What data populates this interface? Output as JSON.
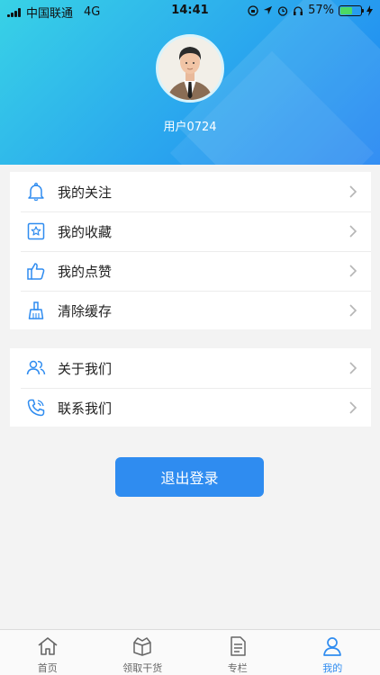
{
  "status_bar": {
    "carrier": "中国联通",
    "network": "4G",
    "time": "14:41",
    "battery": "57%",
    "battery_level": 0.57
  },
  "profile": {
    "username": "用户0724"
  },
  "menu_group_1": [
    {
      "label": "我的关注",
      "icon": "bell-icon"
    },
    {
      "label": "我的收藏",
      "icon": "star-bookmark-icon"
    },
    {
      "label": "我的点赞",
      "icon": "thumbs-up-icon"
    },
    {
      "label": "清除缓存",
      "icon": "broom-icon"
    }
  ],
  "menu_group_2": [
    {
      "label": "关于我们",
      "icon": "users-icon"
    },
    {
      "label": "联系我们",
      "icon": "phone-icon"
    }
  ],
  "logout_label": "退出登录",
  "tabs": [
    {
      "label": "首页",
      "icon": "home-icon",
      "active": false
    },
    {
      "label": "领取干货",
      "icon": "box-icon",
      "active": false
    },
    {
      "label": "专栏",
      "icon": "document-icon",
      "active": false
    },
    {
      "label": "我的",
      "icon": "user-icon",
      "active": true
    }
  ],
  "colors": {
    "accent": "#2f8cf0",
    "header_start": "#38d2e6",
    "header_end": "#1e82f2",
    "battery_fill": "#4cd964"
  }
}
